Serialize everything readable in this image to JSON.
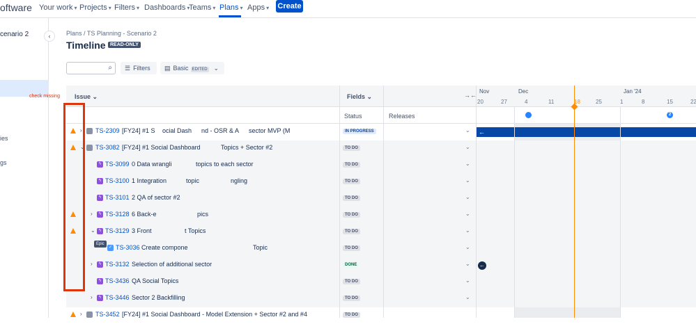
{
  "nav": {
    "brand": "oftware",
    "items": [
      "Your work",
      "Projects",
      "Filters",
      "Dashboards",
      "Teams",
      "Plans",
      "Apps"
    ],
    "create": "Create"
  },
  "sidebar": {
    "project": "cenario 2",
    "fragments": [
      "ies",
      "gs"
    ]
  },
  "breadcrumb": "Plans  /  TS Planning - Scenario 2",
  "title": "Timeline",
  "readonly_badge": "READ-ONLY",
  "toolbar": {
    "filters": "Filters",
    "view": "Basic",
    "edited": "EDITED"
  },
  "annotation": "check missing",
  "tooltip": "Epic",
  "columns": {
    "issue": "Issue",
    "fields": "Fields",
    "status": "Status",
    "releases": "Releases"
  },
  "timeline": {
    "months": [
      "Nov",
      "Dec",
      "Jan '24"
    ],
    "days": [
      "20",
      "27",
      "4",
      "11",
      "18",
      "25",
      "1",
      "8",
      "15",
      "22"
    ],
    "release_count": "2",
    "bar_arrow": "←"
  },
  "rows": [
    {
      "key": "TS-2309",
      "summary": "[FY24] #1 S",
      "summary2": "ocial Dash",
      "summary3": "nd - OSR & A",
      "summary4": "sector MVP (M",
      "status": "IN PROGRESS"
    },
    {
      "key": "TS-3082",
      "summary": "[FY24] #1 Social Dashboard",
      "summary2": "Topics + Sector #2",
      "status": "TO DO"
    },
    {
      "key": "TS-3099",
      "summary": "0 Data wrangli",
      "summary2": "topics to each sector",
      "status": "TO DO"
    },
    {
      "key": "TS-3100",
      "summary": "1 Integration",
      "summary2": "topic",
      "summary3": "ngling",
      "status": "TO DO"
    },
    {
      "key": "TS-3101",
      "summary": "2 QA of sector #2",
      "status": "TO DO"
    },
    {
      "key": "TS-3128",
      "summary": "6 Back-e",
      "summary2": "pics",
      "status": "TO DO"
    },
    {
      "key": "TS-3129",
      "summary": "3 Front",
      "summary2": "t Topics",
      "status": "TO DO"
    },
    {
      "key": "TS-3036",
      "summary": "Create compone",
      "summary2": "Topic",
      "status": "TO DO"
    },
    {
      "key": "TS-3132",
      "summary": "Selection of additional sector",
      "status": "DONE"
    },
    {
      "key": "TS-3436",
      "summary": "QA Social Topics",
      "status": "TO DO"
    },
    {
      "key": "TS-3446",
      "summary": "Sector 2 Backfilling",
      "status": "TO DO"
    },
    {
      "key": "TS-3452",
      "summary": "[FY24] #1 Social Dashboard - Model Extension + Sector #2 and #4",
      "status": "TO DO"
    }
  ]
}
